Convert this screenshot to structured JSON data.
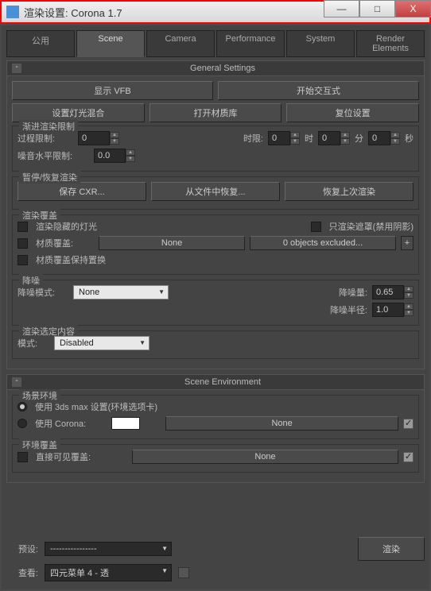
{
  "window": {
    "title": "渲染设置: Corona 1.7",
    "min": "—",
    "max": "□",
    "close": "X"
  },
  "tabs": [
    "公用",
    "Scene",
    "Camera",
    "Performance",
    "System",
    "Render Elements"
  ],
  "general": {
    "title": "General Settings",
    "show_vfb": "显示 VFB",
    "start_interactive": "开始交互式",
    "setup_lightmix": "设置灯光混合",
    "open_matlib": "打开材质库",
    "reset_settings": "复位设置"
  },
  "progressive": {
    "title": "渐进渲染限制",
    "pass_limit_label": "过程限制:",
    "pass_limit": "0",
    "time_limit_label": "时限:",
    "h": "0",
    "h_unit": "时",
    "m": "0",
    "m_unit": "分",
    "s": "0",
    "s_unit": "秒",
    "noise_label": "噪音水平限制:",
    "noise": "0.0"
  },
  "resume": {
    "title": "暂停/恢复渲染",
    "save_cxr": "保存 CXR...",
    "resume_file": "从文件中恢复...",
    "resume_last": "恢复上次渲染"
  },
  "overrides": {
    "title": "渲染覆盖",
    "render_hidden": "渲染隐藏的灯光",
    "only_mask": "只渲染遮罩(禁用阴影)",
    "mtl_override_label": "材质覆盖:",
    "mtl_none": "None",
    "objects_excluded": "0 objects excluded...",
    "preserve": "材质覆盖保持置换"
  },
  "denoise": {
    "title": "降噪",
    "mode_label": "降噪模式:",
    "mode": "None",
    "amount_label": "降噪量:",
    "amount": "0.65",
    "radius_label": "降噪半径:",
    "radius": "1.0"
  },
  "selected": {
    "title": "渲染选定内容",
    "mode_label": "模式:",
    "mode": "Disabled"
  },
  "scene_env": {
    "title": "Scene Environment",
    "group_title": "场景环境",
    "use_max": "使用 3ds max 设置(环境选项卡)",
    "use_corona": "使用 Corona:",
    "none": "None",
    "env_override_title": "环境覆盖",
    "direct_visible": "直接可见覆盖:",
    "none2": "None"
  },
  "footer": {
    "preset_label": "预设:",
    "preset_value": "----------------",
    "view_label": "查看:",
    "view_value": "四元菜单 4 - 透",
    "render": "渲染"
  }
}
